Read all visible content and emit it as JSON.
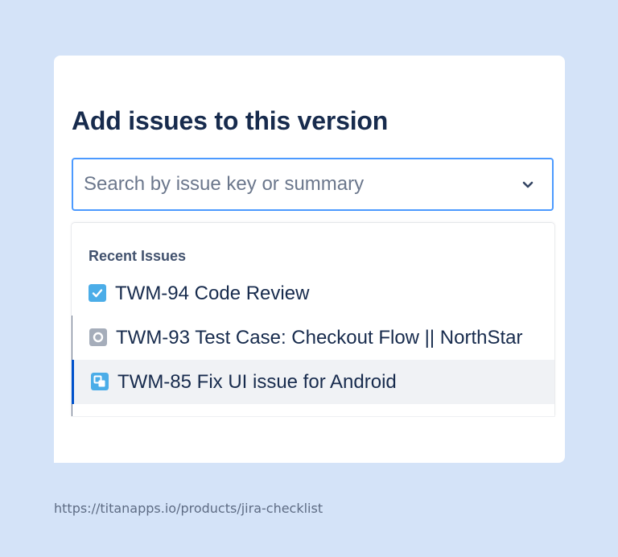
{
  "dialog": {
    "title": "Add issues to this version"
  },
  "search": {
    "placeholder": "Search by issue key or summary",
    "value": ""
  },
  "dropdown": {
    "group_heading": "Recent Issues",
    "items": [
      {
        "label": "TWM-94 Code Review",
        "icon": "checkbox-task-icon"
      },
      {
        "label": "TWM-93 Test Case: Checkout Flow || NorthStar",
        "icon": "test-case-icon"
      },
      {
        "label": "TWM-85 Fix UI issue for Android",
        "icon": "subtask-icon"
      }
    ]
  },
  "footer": {
    "url": "https://titanapps.io/products/jira-checklist"
  },
  "colors": {
    "background": "#d4e3f8",
    "title": "#172b4d",
    "focus_border": "#4c9aff",
    "task_icon": "#4bade8",
    "test_icon": "#a5adba",
    "active_row": "#f0f2f5"
  }
}
